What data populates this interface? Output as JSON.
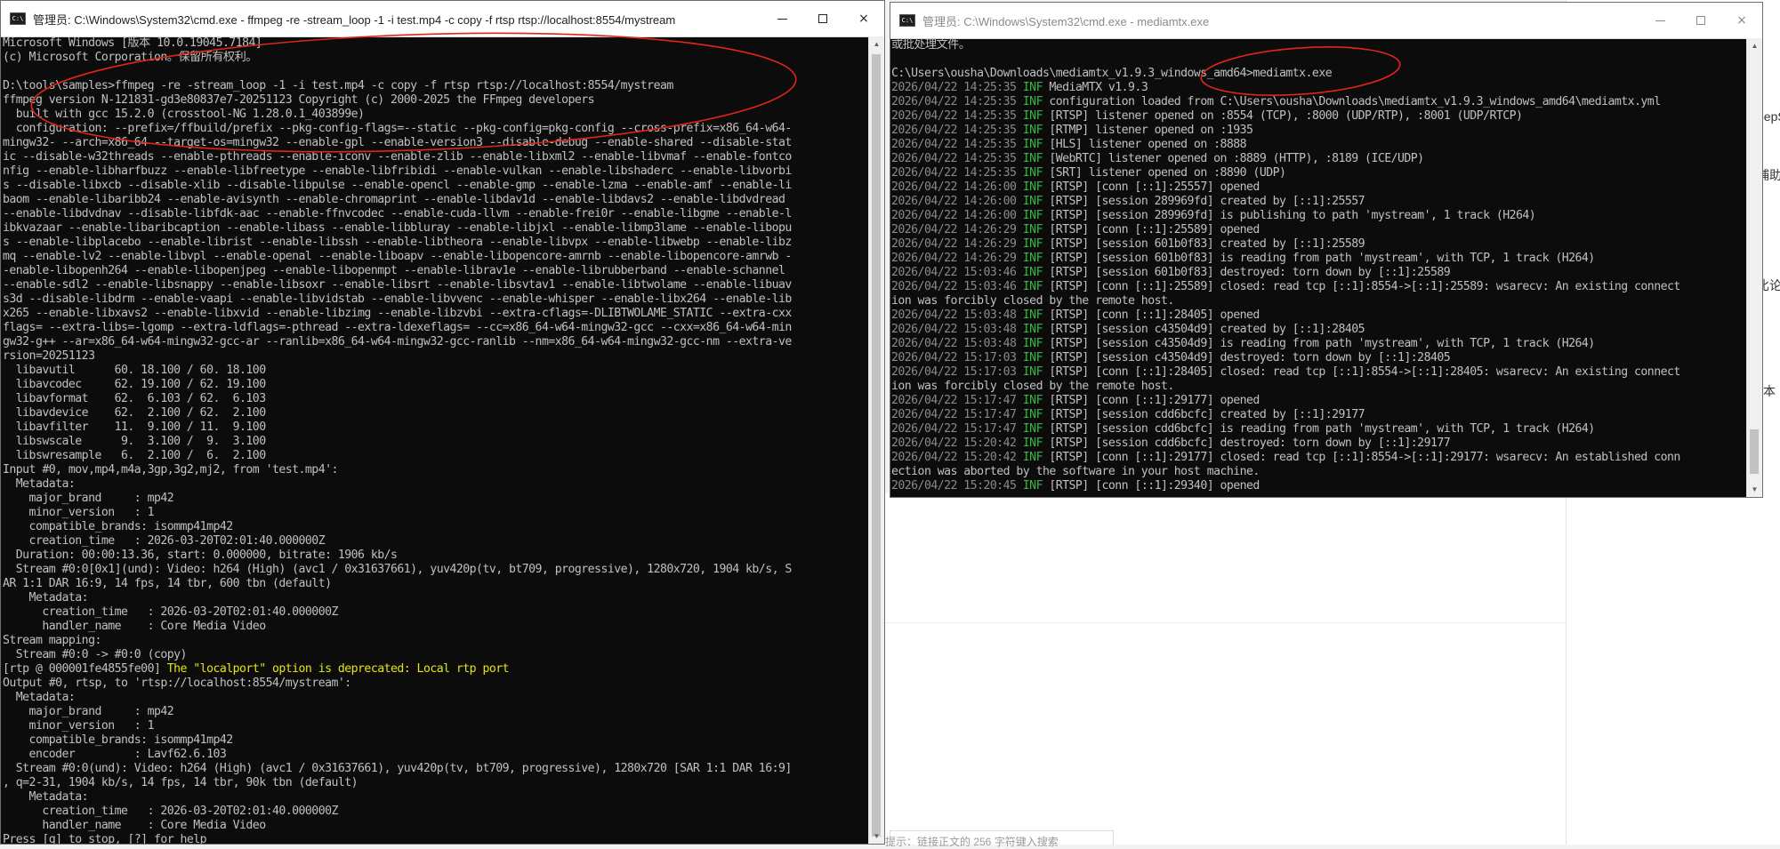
{
  "background": {
    "right_fragments": [
      "eepS",
      "捕助",
      "比论",
      "本"
    ],
    "bottom_text": "提示：链接正文的 256 字符键入搜索"
  },
  "ffmpeg_window": {
    "title": "管理员: C:\\Windows\\System32\\cmd.exe - ffmpeg  -re -stream_loop -1 -i test.mp4 -c copy -f rtsp rtsp://localhost:8554/mystream",
    "icon": "cmd-icon",
    "buttons": {
      "minimize": "minimize-icon",
      "maximize": "maximize-icon",
      "close": "×"
    },
    "lines": [
      "Microsoft Windows [版本 10.0.19045.7184]",
      "(c) Microsoft Corporation。保留所有权利。",
      "",
      "D:\\tools\\samples>ffmpeg -re -stream_loop -1 -i test.mp4 -c copy -f rtsp rtsp://localhost:8554/mystream",
      "ffmpeg version N-121831-gd3e80837e7-20251123 Copyright (c) 2000-2025 the FFmpeg developers",
      "  built with gcc 15.2.0 (crosstool-NG 1.28.0.1_403899e)",
      "  configuration: --prefix=/ffbuild/prefix --pkg-config-flags=--static --pkg-config=pkg-config --cross-prefix=x86_64-w64-",
      "mingw32- --arch=x86_64 --target-os=mingw32 --enable-gpl --enable-version3 --disable-debug --enable-shared --disable-stat",
      "ic --disable-w32threads --enable-pthreads --enable-iconv --enable-zlib --enable-libxml2 --enable-libvmaf --enable-fontco",
      "nfig --enable-libharfbuzz --enable-libfreetype --enable-libfribidi --enable-vulkan --enable-libshaderc --enable-libvorbi",
      "s --disable-libxcb --disable-xlib --disable-libpulse --enable-opencl --enable-gmp --enable-lzma --enable-amf --enable-li",
      "baom --enable-libaribb24 --enable-avisynth --enable-chromaprint --enable-libdav1d --enable-libdavs2 --enable-libdvdread",
      "--enable-libdvdnav --disable-libfdk-aac --enable-ffnvcodec --enable-cuda-llvm --enable-frei0r --enable-libgme --enable-l",
      "ibkvazaar --enable-libaribcaption --enable-libass --enable-libbluray --enable-libjxl --enable-libmp3lame --enable-libopu",
      "s --enable-libplacebo --enable-librist --enable-libssh --enable-libtheora --enable-libvpx --enable-libwebp --enable-libz",
      "mq --enable-lv2 --enable-libvpl --enable-openal --enable-liboapv --enable-libopencore-amrnb --enable-libopencore-amrwb -",
      "-enable-libopenh264 --enable-libopenjpeg --enable-libopenmpt --enable-librav1e --enable-librubberband --enable-schannel",
      "--enable-sdl2 --enable-libsnappy --enable-libsoxr --enable-libsrt --enable-libsvtav1 --enable-libtwolame --enable-libuav",
      "s3d --disable-libdrm --enable-vaapi --enable-libvidstab --enable-libvvenc --enable-whisper --enable-libx264 --enable-lib",
      "x265 --enable-libxavs2 --enable-libxvid --enable-libzimg --enable-libzvbi --extra-cflags=-DLIBTWOLAME_STATIC --extra-cxx",
      "flags= --extra-libs=-lgomp --extra-ldflags=-pthread --extra-ldexeflags= --cc=x86_64-w64-mingw32-gcc --cxx=x86_64-w64-min",
      "gw32-g++ --ar=x86_64-w64-mingw32-gcc-ar --ranlib=x86_64-w64-mingw32-gcc-ranlib --nm=x86_64-w64-mingw32-gcc-nm --extra-ve",
      "rsion=20251123",
      "  libavutil      60. 18.100 / 60. 18.100",
      "  libavcodec     62. 19.100 / 62. 19.100",
      "  libavformat    62.  6.103 / 62.  6.103",
      "  libavdevice    62.  2.100 / 62.  2.100",
      "  libavfilter    11.  9.100 / 11.  9.100",
      "  libswscale      9.  3.100 /  9.  3.100",
      "  libswresample   6.  2.100 /  6.  2.100",
      "Input #0, mov,mp4,m4a,3gp,3g2,mj2, from 'test.mp4':",
      "  Metadata:",
      "    major_brand     : mp42",
      "    minor_version   : 1",
      "    compatible_brands: isommp41mp42",
      "    creation_time   : 2026-03-20T02:01:40.000000Z",
      "  Duration: 00:00:13.36, start: 0.000000, bitrate: 1906 kb/s",
      "  Stream #0:0[0x1](und): Video: h264 (High) (avc1 / 0x31637661), yuv420p(tv, bt709, progressive), 1280x720, 1904 kb/s, S",
      "AR 1:1 DAR 16:9, 14 fps, 14 tbr, 600 tbn (default)",
      "    Metadata:",
      "      creation_time   : 2026-03-20T02:01:40.000000Z",
      "      handler_name    : Core Media Video",
      "Stream mapping:",
      "  Stream #0:0 -> #0:0 (copy)",
      "[rtp @ 000001fe4855fe00] The \"localport\" option is deprecated: Local rtp port",
      "Output #0, rtsp, to 'rtsp://localhost:8554/mystream':",
      "  Metadata:",
      "    major_brand     : mp42",
      "    minor_version   : 1",
      "    compatible_brands: isommp41mp42",
      "    encoder         : Lavf62.6.103",
      "  Stream #0:0(und): Video: h264 (High) (avc1 / 0x31637661), yuv420p(tv, bt709, progressive), 1280x720 [SAR 1:1 DAR 16:9]",
      ", q=2-31, 1904 kb/s, 14 fps, 14 tbr, 90k tbn (default)",
      "    Metadata:",
      "      creation_time   : 2026-03-20T02:01:40.000000Z",
      "      handler_name    : Core Media Video",
      "Press [q] to stop, [?] for help"
    ]
  },
  "mediamtx_window": {
    "title": "管理员: C:\\Windows\\System32\\cmd.exe - mediamtx.exe",
    "icon": "cmd-icon",
    "buttons": {
      "minimize": "minimize-icon",
      "maximize": "maximize-icon",
      "close": "×"
    },
    "prefix_lines": [
      "或批处理文件。",
      "",
      "C:\\Users\\ousha\\Downloads\\mediamtx_v1.9.3_windows_amd64>mediamtx.exe"
    ],
    "log_level": "INF",
    "log": [
      {
        "ts": "2026/04/22 14:25:35",
        "msg": "MediaMTX v1.9.3"
      },
      {
        "ts": "2026/04/22 14:25:35",
        "msg": "configuration loaded from C:\\Users\\ousha\\Downloads\\mediamtx_v1.9.3_windows_amd64\\mediamtx.yml"
      },
      {
        "ts": "2026/04/22 14:25:35",
        "msg": "[RTSP] listener opened on :8554 (TCP), :8000 (UDP/RTP), :8001 (UDP/RTCP)"
      },
      {
        "ts": "2026/04/22 14:25:35",
        "msg": "[RTMP] listener opened on :1935"
      },
      {
        "ts": "2026/04/22 14:25:35",
        "msg": "[HLS] listener opened on :8888"
      },
      {
        "ts": "2026/04/22 14:25:35",
        "msg": "[WebRTC] listener opened on :8889 (HTTP), :8189 (ICE/UDP)"
      },
      {
        "ts": "2026/04/22 14:25:35",
        "msg": "[SRT] listener opened on :8890 (UDP)"
      },
      {
        "ts": "2026/04/22 14:26:00",
        "msg": "[RTSP] [conn [::1]:25557] opened"
      },
      {
        "ts": "2026/04/22 14:26:00",
        "msg": "[RTSP] [session 289969fd] created by [::1]:25557"
      },
      {
        "ts": "2026/04/22 14:26:00",
        "msg": "[RTSP] [session 289969fd] is publishing to path 'mystream', 1 track (H264)"
      },
      {
        "ts": "2026/04/22 14:26:29",
        "msg": "[RTSP] [conn [::1]:25589] opened"
      },
      {
        "ts": "2026/04/22 14:26:29",
        "msg": "[RTSP] [session 601b0f83] created by [::1]:25589"
      },
      {
        "ts": "2026/04/22 14:26:29",
        "msg": "[RTSP] [session 601b0f83] is reading from path 'mystream', with TCP, 1 track (H264)"
      },
      {
        "ts": "2026/04/22 15:03:46",
        "msg": "[RTSP] [session 601b0f83] destroyed: torn down by [::1]:25589"
      },
      {
        "ts": "2026/04/22 15:03:46",
        "msg": "[RTSP] [conn [::1]:25589] closed: read tcp [::1]:8554->[::1]:25589: wsarecv: An existing connect"
      },
      {
        "ts": "",
        "msg": "ion was forcibly closed by the remote host."
      },
      {
        "ts": "2026/04/22 15:03:48",
        "msg": "[RTSP] [conn [::1]:28405] opened"
      },
      {
        "ts": "2026/04/22 15:03:48",
        "msg": "[RTSP] [session c43504d9] created by [::1]:28405"
      },
      {
        "ts": "2026/04/22 15:03:48",
        "msg": "[RTSP] [session c43504d9] is reading from path 'mystream', with TCP, 1 track (H264)"
      },
      {
        "ts": "2026/04/22 15:17:03",
        "msg": "[RTSP] [session c43504d9] destroyed: torn down by [::1]:28405"
      },
      {
        "ts": "2026/04/22 15:17:03",
        "msg": "[RTSP] [conn [::1]:28405] closed: read tcp [::1]:8554->[::1]:28405: wsarecv: An existing connect"
      },
      {
        "ts": "",
        "msg": "ion was forcibly closed by the remote host."
      },
      {
        "ts": "2026/04/22 15:17:47",
        "msg": "[RTSP] [conn [::1]:29177] opened"
      },
      {
        "ts": "2026/04/22 15:17:47",
        "msg": "[RTSP] [session cdd6bcfc] created by [::1]:29177"
      },
      {
        "ts": "2026/04/22 15:17:47",
        "msg": "[RTSP] [session cdd6bcfc] is reading from path 'mystream', with TCP, 1 track (H264)"
      },
      {
        "ts": "2026/04/22 15:20:42",
        "msg": "[RTSP] [session cdd6bcfc] destroyed: torn down by [::1]:29177"
      },
      {
        "ts": "2026/04/22 15:20:42",
        "msg": "[RTSP] [conn [::1]:29177] closed: read tcp [::1]:8554->[::1]:29177: wsarecv: An established conn"
      },
      {
        "ts": "",
        "msg": "ection was aborted by the software in your host machine."
      },
      {
        "ts": "2026/04/22 15:20:45",
        "msg": "[RTSP] [conn [::1]:29340] opened"
      }
    ]
  },
  "colors": {
    "console_bg": "#0c0c0c",
    "console_text": "#c0c0c0",
    "info_green": "#3fb53f",
    "timestamp_gray": "#8a8a8a",
    "warning_yellow": "#e5e510",
    "annotation_red": "#e0251b"
  }
}
